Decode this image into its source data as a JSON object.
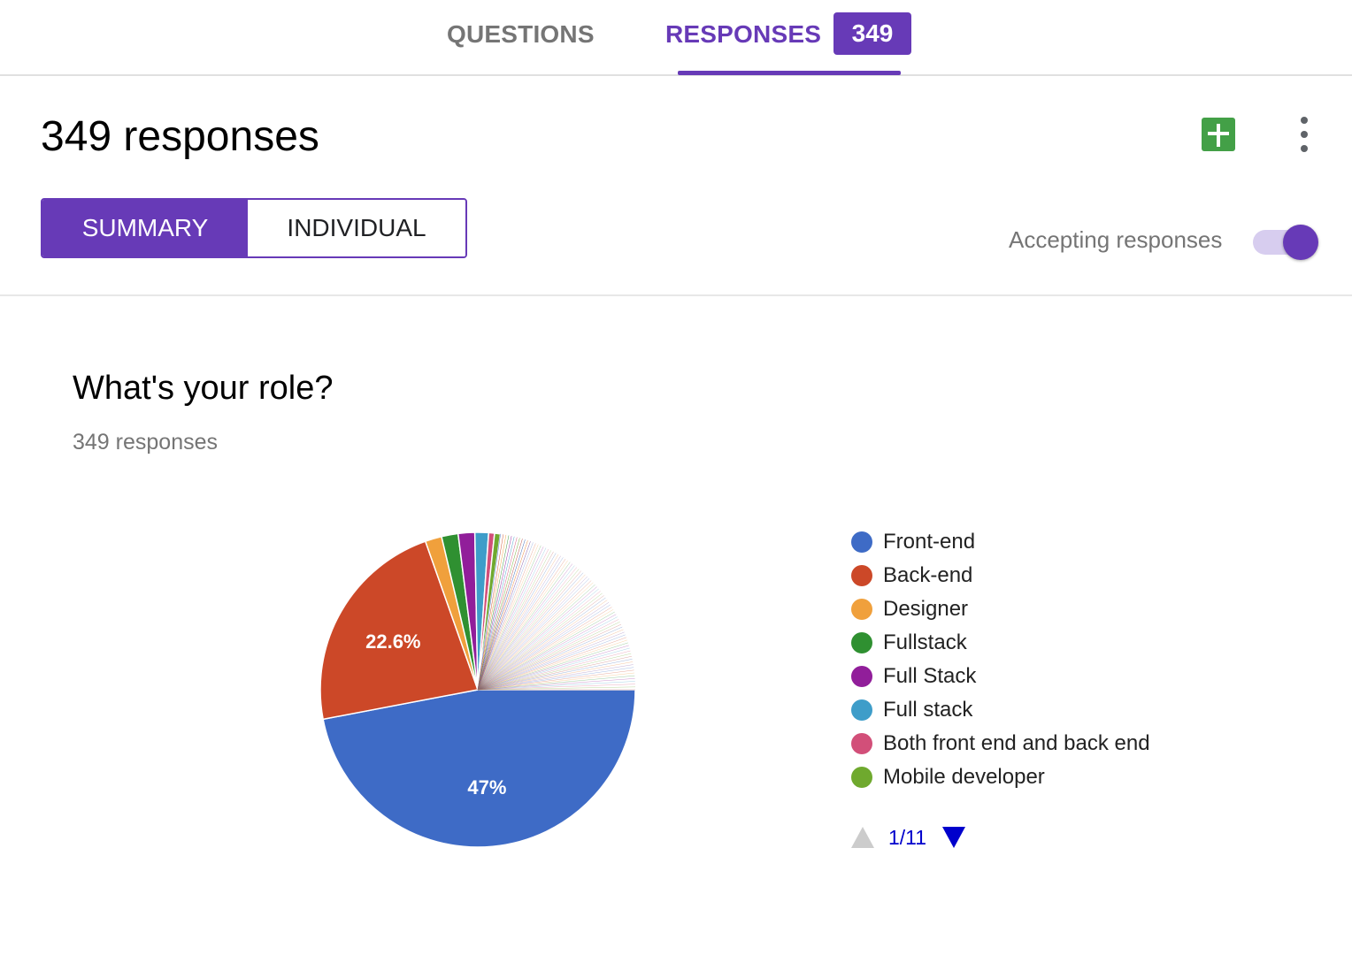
{
  "top_tabs": {
    "questions_label": "QUESTIONS",
    "responses_label": "RESPONSES",
    "responses_count": "349",
    "accent_color": "#673ab7"
  },
  "header": {
    "title": "349 responses",
    "sheets_icon": "google-sheets-icon",
    "more_icon": "more-vert-icon"
  },
  "view_toggle": {
    "summary_label": "SUMMARY",
    "individual_label": "INDIVIDUAL",
    "selected": "SUMMARY"
  },
  "accepting": {
    "label": "Accepting responses",
    "enabled": true
  },
  "question": {
    "title": "What's your role?",
    "response_count": "349 responses"
  },
  "chart_data": {
    "type": "pie",
    "categories": [
      "Front-end",
      "Back-end",
      "Designer",
      "Fullstack",
      "Full Stack",
      "Full stack",
      "Both front end and back end",
      "Mobile developer"
    ],
    "values": [
      47.0,
      22.6,
      1.7,
      1.7,
      1.7,
      1.4,
      0.6,
      0.6
    ],
    "other_responses_percent": 22.7,
    "slice_labels": [
      "47%",
      "22.6%"
    ],
    "colors": [
      "#3e6bc6",
      "#cc4828",
      "#f0a03c",
      "#2f9031",
      "#911e9a",
      "#3e9dc9",
      "#d24f79",
      "#6fa92e"
    ],
    "legend_position": "right",
    "legend_page": "1/11"
  }
}
